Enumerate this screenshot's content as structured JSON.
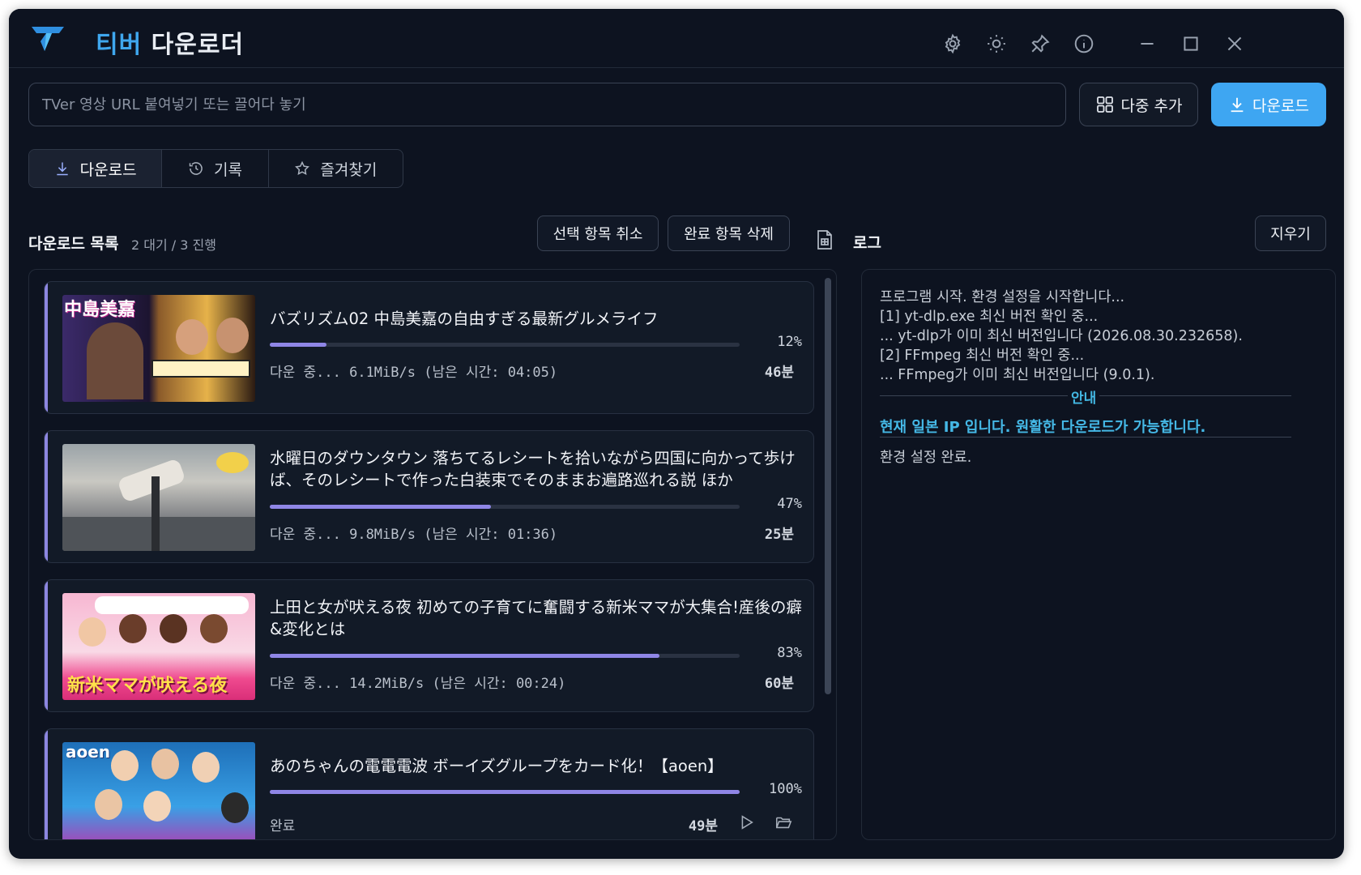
{
  "app": {
    "title_part1": "티버",
    "title_part2": "다운로더",
    "accent": "#3ea6f2",
    "progress_color": "#8f86e6"
  },
  "titlebar_icons": [
    "gear-icon",
    "sun-icon",
    "pin-icon",
    "info-icon",
    "minimize-icon",
    "maximize-icon",
    "close-icon"
  ],
  "url_bar": {
    "placeholder": "TVer 영상 URL 붙여넣기 또는 끌어다 놓기",
    "value": "",
    "multi_add_label": "다중 추가",
    "download_label": "다운로드"
  },
  "tabs": [
    {
      "label": "다운로드",
      "icon": "download-icon",
      "active": true
    },
    {
      "label": "기록",
      "icon": "history-icon",
      "active": false
    },
    {
      "label": "즐겨찾기",
      "icon": "star-icon",
      "active": false
    }
  ],
  "list": {
    "title": "다운로드 목록",
    "count": "2 대기 / 3 진행",
    "deselect_label": "선택 항목 취소",
    "delete_done_label": "완료 항목 삭제"
  },
  "log": {
    "title": "로그",
    "clear_label": "지우기",
    "lines": [
      "프로그램 시작. 환경 설정을 시작합니다...",
      "[1] yt-dlp.exe 최신 버전 확인 중...",
      "... yt-dlp가 이미 최신 버전입니다 (2026.08.30.232658).",
      "[2] FFmpeg 최신 버전 확인 중...",
      "... FFmpeg가 이미 최신 버전입니다 (9.0.1)."
    ],
    "notice_label": "안내",
    "notice_text": "현재 일본 IP 입니다. 원활한 다운로드가 가능합니다.",
    "final_line": "환경 설정 완료."
  },
  "downloads": [
    {
      "title": "バズリズム02 中島美嘉の自由すぎる最新グルメライフ",
      "progress": 0.12,
      "percent_label": "12%",
      "status": "다운 중... 6.1MiB/s (남은 시간: 04:05)",
      "duration": "46분",
      "thumb_text": "中島美嘉"
    },
    {
      "title": "水曜日のダウンタウン 落ちてるレシートを拾いながら四国に向かって歩けば、そのレシートで作った白装束でそのままお遍路巡れる説 ほか",
      "progress": 0.47,
      "percent_label": "47%",
      "status": "다운 중... 9.8MiB/s (남은 시간: 01:36)",
      "duration": "25분",
      "thumb_text": ""
    },
    {
      "title": "上田と女が吠える夜 初めての子育てに奮闘する新米ママが大集合!産後の癖&変化とは",
      "progress": 0.83,
      "percent_label": "83%",
      "status": "다운 중... 14.2MiB/s (남은 시간: 00:24)",
      "duration": "60분",
      "thumb_text": "新米ママが吠える夜"
    },
    {
      "title": "あのちゃんの電電電波 ボーイズグループをカード化！【aoen】",
      "progress": 1.0,
      "percent_label": "100%",
      "status": "완료",
      "duration": "49분",
      "thumb_text": "aoen"
    }
  ]
}
